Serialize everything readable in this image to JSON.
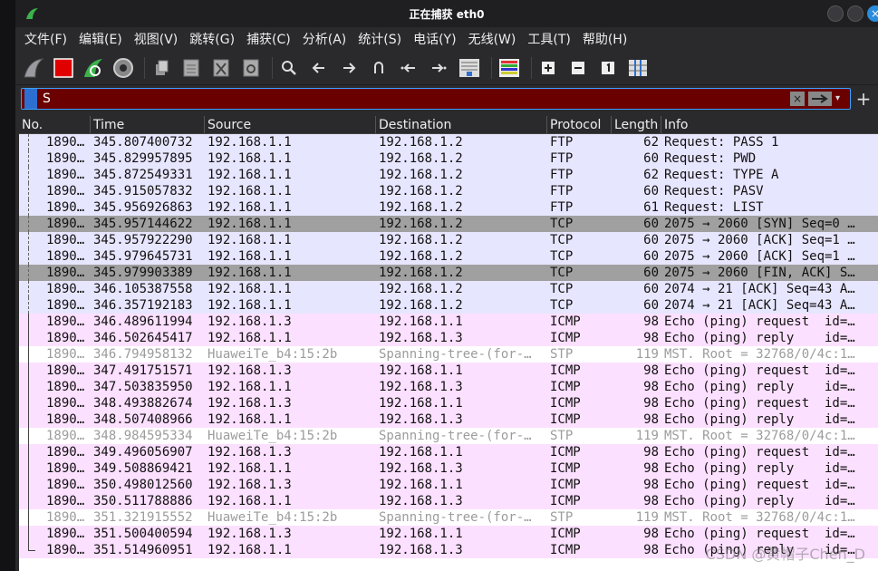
{
  "window": {
    "title": "正在捕获 eth0"
  },
  "menu": [
    "文件(F)",
    "编辑(E)",
    "视图(V)",
    "跳转(G)",
    "捕获(C)",
    "分析(A)",
    "统计(S)",
    "电话(Y)",
    "无线(W)",
    "工具(T)",
    "帮助(H)"
  ],
  "filter": {
    "value": "S"
  },
  "columns": [
    "No.",
    "Time",
    "Source",
    "Destination",
    "Protocol",
    "Length",
    "Info"
  ],
  "packets": [
    {
      "no": "1890…",
      "time": "345.807400732",
      "src": "192.168.1.1",
      "dst": "192.168.1.2",
      "proto": "FTP",
      "len": "62",
      "info": "Request: PASS 1",
      "cls": "ftp"
    },
    {
      "no": "1890…",
      "time": "345.829957895",
      "src": "192.168.1.1",
      "dst": "192.168.1.2",
      "proto": "FTP",
      "len": "60",
      "info": "Request: PWD",
      "cls": "ftp"
    },
    {
      "no": "1890…",
      "time": "345.872549331",
      "src": "192.168.1.1",
      "dst": "192.168.1.2",
      "proto": "FTP",
      "len": "62",
      "info": "Request: TYPE A",
      "cls": "ftp"
    },
    {
      "no": "1890…",
      "time": "345.915057832",
      "src": "192.168.1.1",
      "dst": "192.168.1.2",
      "proto": "FTP",
      "len": "60",
      "info": "Request: PASV",
      "cls": "ftp"
    },
    {
      "no": "1890…",
      "time": "345.956926863",
      "src": "192.168.1.1",
      "dst": "192.168.1.2",
      "proto": "FTP",
      "len": "61",
      "info": "Request: LIST",
      "cls": "ftp"
    },
    {
      "no": "1890…",
      "time": "345.957144622",
      "src": "192.168.1.1",
      "dst": "192.168.1.2",
      "proto": "TCP",
      "len": "60",
      "info": "2075 → 2060 [SYN] Seq=0 …",
      "cls": "sel"
    },
    {
      "no": "1890…",
      "time": "345.957922290",
      "src": "192.168.1.1",
      "dst": "192.168.1.2",
      "proto": "TCP",
      "len": "60",
      "info": "2075 → 2060 [ACK] Seq=1 …",
      "cls": "tcp"
    },
    {
      "no": "1890…",
      "time": "345.979645731",
      "src": "192.168.1.1",
      "dst": "192.168.1.2",
      "proto": "TCP",
      "len": "60",
      "info": "2075 → 2060 [ACK] Seq=1 …",
      "cls": "tcp"
    },
    {
      "no": "1890…",
      "time": "345.979903389",
      "src": "192.168.1.1",
      "dst": "192.168.1.2",
      "proto": "TCP",
      "len": "60",
      "info": "2075 → 2060 [FIN, ACK] S…",
      "cls": "sel"
    },
    {
      "no": "1890…",
      "time": "346.105387558",
      "src": "192.168.1.1",
      "dst": "192.168.1.2",
      "proto": "TCP",
      "len": "60",
      "info": "2074 → 21 [ACK] Seq=43 A…",
      "cls": "tcp"
    },
    {
      "no": "1890…",
      "time": "346.357192183",
      "src": "192.168.1.1",
      "dst": "192.168.1.2",
      "proto": "TCP",
      "len": "60",
      "info": "2074 → 21 [ACK] Seq=43 A…",
      "cls": "tcp"
    },
    {
      "no": "1890…",
      "time": "346.489611994",
      "src": "192.168.1.3",
      "dst": "192.168.1.1",
      "proto": "ICMP",
      "len": "98",
      "info": "Echo (ping) request  id=…",
      "cls": "icmp"
    },
    {
      "no": "1890…",
      "time": "346.502645417",
      "src": "192.168.1.1",
      "dst": "192.168.1.3",
      "proto": "ICMP",
      "len": "98",
      "info": "Echo (ping) reply    id=…",
      "cls": "icmp"
    },
    {
      "no": "1890…",
      "time": "346.794958132",
      "src": "HuaweiTe_b4:15:2b",
      "dst": "Spanning-tree-(for-…",
      "proto": "STP",
      "len": "119",
      "info": "MST. Root = 32768/0/4c:1…",
      "cls": "stp"
    },
    {
      "no": "1890…",
      "time": "347.491751571",
      "src": "192.168.1.3",
      "dst": "192.168.1.1",
      "proto": "ICMP",
      "len": "98",
      "info": "Echo (ping) request  id=…",
      "cls": "icmp"
    },
    {
      "no": "1890…",
      "time": "347.503835950",
      "src": "192.168.1.1",
      "dst": "192.168.1.3",
      "proto": "ICMP",
      "len": "98",
      "info": "Echo (ping) reply    id=…",
      "cls": "icmp"
    },
    {
      "no": "1890…",
      "time": "348.493882674",
      "src": "192.168.1.3",
      "dst": "192.168.1.1",
      "proto": "ICMP",
      "len": "98",
      "info": "Echo (ping) request  id=…",
      "cls": "icmp"
    },
    {
      "no": "1890…",
      "time": "348.507408966",
      "src": "192.168.1.1",
      "dst": "192.168.1.3",
      "proto": "ICMP",
      "len": "98",
      "info": "Echo (ping) reply    id=…",
      "cls": "icmp"
    },
    {
      "no": "1890…",
      "time": "348.984595334",
      "src": "HuaweiTe_b4:15:2b",
      "dst": "Spanning-tree-(for-…",
      "proto": "STP",
      "len": "119",
      "info": "MST. Root = 32768/0/4c:1…",
      "cls": "stp"
    },
    {
      "no": "1890…",
      "time": "349.496056907",
      "src": "192.168.1.3",
      "dst": "192.168.1.1",
      "proto": "ICMP",
      "len": "98",
      "info": "Echo (ping) request  id=…",
      "cls": "icmp"
    },
    {
      "no": "1890…",
      "time": "349.508869421",
      "src": "192.168.1.1",
      "dst": "192.168.1.3",
      "proto": "ICMP",
      "len": "98",
      "info": "Echo (ping) reply    id=…",
      "cls": "icmp"
    },
    {
      "no": "1890…",
      "time": "350.498012560",
      "src": "192.168.1.3",
      "dst": "192.168.1.1",
      "proto": "ICMP",
      "len": "98",
      "info": "Echo (ping) request  id=…",
      "cls": "icmp"
    },
    {
      "no": "1890…",
      "time": "350.511788886",
      "src": "192.168.1.1",
      "dst": "192.168.1.3",
      "proto": "ICMP",
      "len": "98",
      "info": "Echo (ping) reply    id=…",
      "cls": "icmp"
    },
    {
      "no": "1890…",
      "time": "351.321915552",
      "src": "HuaweiTe_b4:15:2b",
      "dst": "Spanning-tree-(for-…",
      "proto": "STP",
      "len": "119",
      "info": "MST. Root = 32768/0/4c:1…",
      "cls": "stp"
    },
    {
      "no": "1890…",
      "time": "351.500400594",
      "src": "192.168.1.3",
      "dst": "192.168.1.1",
      "proto": "ICMP",
      "len": "98",
      "info": "Echo (ping) request  id=…",
      "cls": "icmp"
    },
    {
      "no": "1890…",
      "time": "351.514960951",
      "src": "192.168.1.1",
      "dst": "192.168.1.3",
      "proto": "ICMP",
      "len": "98",
      "info": "Echo (ping) reply    id=…",
      "cls": "icmp"
    }
  ],
  "watermark": "CSDN @黄帽子Chen_D",
  "icons": [
    "shark-fin-start-icon",
    "stop-capture-icon",
    "restart-capture-icon",
    "capture-options-icon",
    "open-file-icon",
    "save-file-icon",
    "close-file-icon",
    "reload-file-icon",
    "find-packet-icon",
    "go-back-icon",
    "go-forward-icon",
    "go-to-packet-icon",
    "first-packet-icon",
    "last-packet-icon",
    "autoscroll-icon",
    "colorize-icon",
    "zoom-in-icon",
    "zoom-out-icon",
    "normal-size-icon",
    "resize-columns-icon"
  ],
  "colors": {
    "ftp_tcp_row": "#e7e6ff",
    "icmp_row": "#fce0ff",
    "selected_row": "#a0a0a0",
    "filter_bg": "#6a0000"
  }
}
